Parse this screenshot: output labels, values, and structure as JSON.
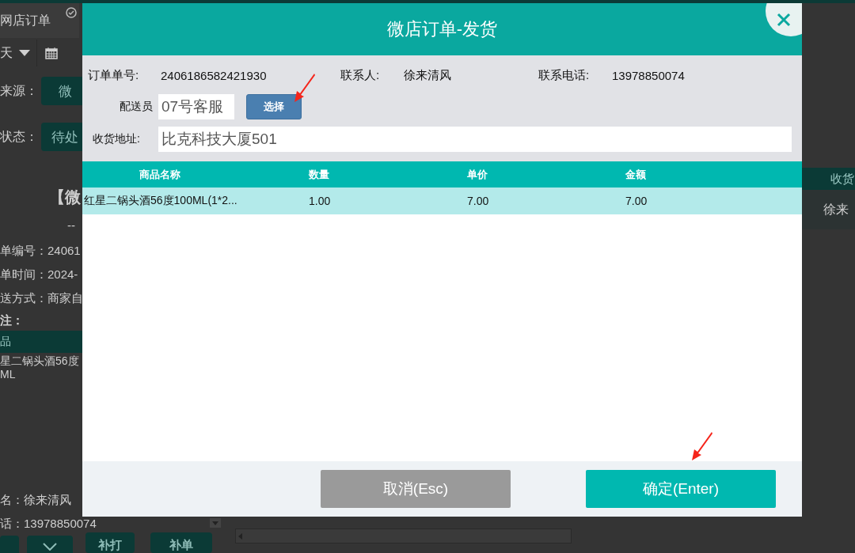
{
  "background": {
    "tab_title": "网店订单",
    "date_range": "天",
    "filters": [
      {
        "label": "来源：",
        "value": "微"
      },
      {
        "label": "状态：",
        "value": "待处"
      }
    ],
    "order_card": {
      "title": "【微",
      "status": "--",
      "fields": [
        "单编号：24061",
        "单时间：2024-",
        "送方式：商家自"
      ],
      "remark_label": "注：",
      "items_header": "品",
      "item_lines": [
        "星二锅头酒56度",
        "ML"
      ],
      "contacts": [
        "名：徐来清风",
        "话：13978850074"
      ]
    },
    "buttons": [
      "补打",
      "补单"
    ],
    "table_header": "收货",
    "table_cell": "徐来"
  },
  "dialog": {
    "title": "微店订单-发货",
    "info": [
      {
        "label": "订单单号:",
        "value": "2406186582421930"
      },
      {
        "label": "联系人:",
        "value": "徐来清风"
      },
      {
        "label": "联系电话:",
        "value": "13978850074"
      }
    ],
    "courier": {
      "label": "配送员",
      "value": "07号客服",
      "button": "选择"
    },
    "address": {
      "label": "收货地址:",
      "value": "比克科技大厦501"
    },
    "table": {
      "columns": [
        "商品名称",
        "数量",
        "单价",
        "金额"
      ],
      "rows": [
        {
          "cells": [
            "红星二锅头酒56度100ML(1*2...",
            "1.00",
            "7.00",
            "7.00"
          ],
          "selected": true
        }
      ]
    },
    "buttons": [
      {
        "kind": "cancel",
        "label": "取消(Esc)"
      },
      {
        "kind": "confirm",
        "label": "确定(Enter)"
      }
    ]
  }
}
